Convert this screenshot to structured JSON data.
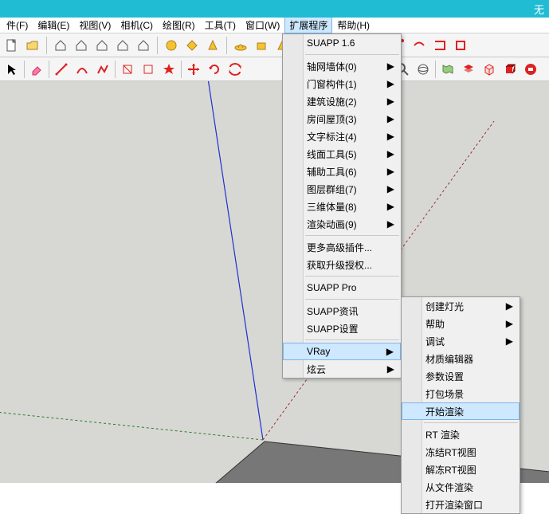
{
  "title_fragment": "无",
  "menubar": {
    "items": [
      {
        "label": "件(F)"
      },
      {
        "label": "编辑(E)"
      },
      {
        "label": "视图(V)"
      },
      {
        "label": "相机(C)"
      },
      {
        "label": "绘图(R)"
      },
      {
        "label": "工具(T)"
      },
      {
        "label": "窗口(W)"
      },
      {
        "label": "扩展程序",
        "active": true
      },
      {
        "label": "帮助(H)"
      }
    ]
  },
  "dropdown1": {
    "groups": [
      [
        {
          "label": "SUAPP 1.6"
        }
      ],
      [
        {
          "label": "轴网墙体(0)",
          "sub": true
        },
        {
          "label": "门窗构件(1)",
          "sub": true
        },
        {
          "label": "建筑设施(2)",
          "sub": true
        },
        {
          "label": "房间屋顶(3)",
          "sub": true
        },
        {
          "label": "文字标注(4)",
          "sub": true
        },
        {
          "label": "线面工具(5)",
          "sub": true
        },
        {
          "label": "辅助工具(6)",
          "sub": true
        },
        {
          "label": "图层群组(7)",
          "sub": true
        },
        {
          "label": "三维体量(8)",
          "sub": true
        },
        {
          "label": "渲染动画(9)",
          "sub": true
        }
      ],
      [
        {
          "label": "更多高级插件..."
        },
        {
          "label": "获取升级授权..."
        }
      ],
      [
        {
          "label": "SUAPP Pro"
        }
      ],
      [
        {
          "label": "SUAPP资讯"
        },
        {
          "label": "SUAPP设置"
        }
      ],
      [
        {
          "label": "VRay",
          "sub": true,
          "hover": true
        },
        {
          "label": "炫云",
          "sub": true
        }
      ]
    ]
  },
  "dropdown2": {
    "groups": [
      [
        {
          "label": "创建灯光",
          "sub": true
        },
        {
          "label": "帮助",
          "sub": true
        },
        {
          "label": "调试",
          "sub": true
        },
        {
          "label": "材质编辑器"
        },
        {
          "label": "参数设置"
        },
        {
          "label": "打包场景"
        },
        {
          "label": "开始渲染",
          "hover": true
        }
      ],
      [
        {
          "label": "RT 渲染"
        },
        {
          "label": "冻结RT视图"
        },
        {
          "label": "解冻RT视图"
        },
        {
          "label": "从文件渲染"
        },
        {
          "label": "打开渲染窗口"
        }
      ]
    ]
  },
  "arrow_glyph": "▶"
}
